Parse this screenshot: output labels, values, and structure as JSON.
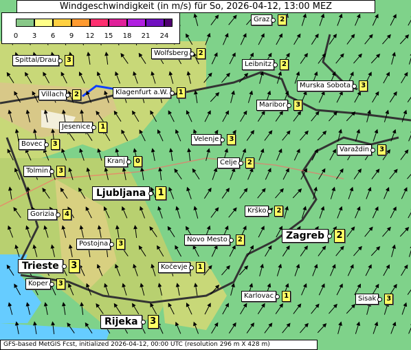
{
  "title": "Windgeschwindigkeit (in m/s) für So, 2026-04-12, 13:00 MEZ",
  "footer": "GFS-based MetGIS Fcst, initialized 2026-04-12, 00:00 UTC  (resolution 296 m X 428 m)",
  "legend": {
    "ticks": [
      "0",
      "3",
      "6",
      "9",
      "12",
      "15",
      "18",
      "21",
      "24"
    ],
    "colors": [
      "#88c888",
      "#ffff88",
      "#ffd040",
      "#ff9a30",
      "#ff3070",
      "#e0209a",
      "#b020e0",
      "#7010c0",
      "#500070"
    ]
  },
  "cities": [
    {
      "name": "Graz",
      "value": "2",
      "big": false,
      "id": "graz"
    },
    {
      "name": "Wolfsberg",
      "value": "2",
      "big": false,
      "id": "wolfsberg"
    },
    {
      "name": "Spittal/Drau",
      "value": "3",
      "big": false,
      "id": "spittal"
    },
    {
      "name": "Leibnitz",
      "value": "2",
      "big": false,
      "id": "leibnitz"
    },
    {
      "name": "Villach",
      "value": "2",
      "big": false,
      "id": "villach"
    },
    {
      "name": "Klagenfurt a.W.",
      "value": "1",
      "big": false,
      "id": "klagenfurt"
    },
    {
      "name": "Murska Sobota",
      "value": "3",
      "big": false,
      "id": "murska"
    },
    {
      "name": "Maribor",
      "value": "3",
      "big": false,
      "id": "maribor"
    },
    {
      "name": "Jesenice",
      "value": "1",
      "big": false,
      "id": "jesenice"
    },
    {
      "name": "Bovec",
      "value": "3",
      "big": false,
      "id": "bovec"
    },
    {
      "name": "Velenje",
      "value": "3",
      "big": false,
      "id": "velenje"
    },
    {
      "name": "Varaždin",
      "value": "3",
      "big": false,
      "id": "varazdin"
    },
    {
      "name": "Kranj",
      "value": "0",
      "big": false,
      "id": "kranj"
    },
    {
      "name": "Celje",
      "value": "2",
      "big": false,
      "id": "celje"
    },
    {
      "name": "Tolmin",
      "value": "3",
      "big": false,
      "id": "tolmin"
    },
    {
      "name": "Ljubljana",
      "value": "1",
      "big": true,
      "id": "ljubljana"
    },
    {
      "name": "Gorizia",
      "value": "4",
      "big": false,
      "id": "gorizia"
    },
    {
      "name": "Krško",
      "value": "2",
      "big": false,
      "id": "krsko"
    },
    {
      "name": "Zagreb",
      "value": "2",
      "big": true,
      "id": "zagreb"
    },
    {
      "name": "Novo Mesto",
      "value": "2",
      "big": false,
      "id": "novomesto"
    },
    {
      "name": "Postojna",
      "value": "3",
      "big": false,
      "id": "postojna"
    },
    {
      "name": "Trieste",
      "value": "3",
      "big": true,
      "id": "trieste"
    },
    {
      "name": "Kočevje",
      "value": "1",
      "big": false,
      "id": "kocevje"
    },
    {
      "name": "Koper",
      "value": "3",
      "big": false,
      "id": "koper"
    },
    {
      "name": "Karlovac",
      "value": "1",
      "big": false,
      "id": "karlovac"
    },
    {
      "name": "Sisak",
      "value": "3",
      "big": false,
      "id": "sisak"
    },
    {
      "name": "Rijeka",
      "value": "3",
      "big": true,
      "id": "rijeka"
    }
  ]
}
